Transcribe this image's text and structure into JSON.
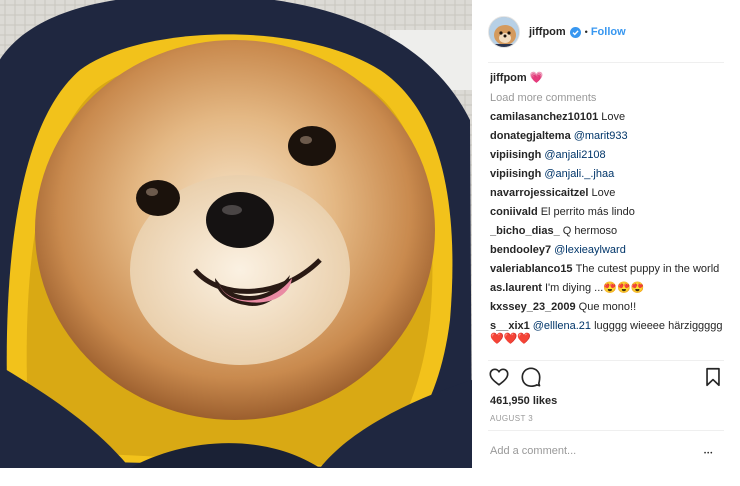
{
  "header": {
    "username": "jiffpom",
    "separator": "•",
    "follow_label": "Follow"
  },
  "caption": {
    "username": "jiffpom",
    "emoji": "💗"
  },
  "load_more_label": "Load more comments",
  "comments": [
    {
      "user": "camilasanchez10101",
      "text": "Love",
      "mention": ""
    },
    {
      "user": "donategjaltema",
      "text": "",
      "mention": "@marit933"
    },
    {
      "user": "vipiisingh",
      "text": "",
      "mention": "@anjali2108"
    },
    {
      "user": "vipiisingh",
      "text": "",
      "mention": "@anjali._.jhaa"
    },
    {
      "user": "navarrojessicaitzel",
      "text": "Love",
      "mention": ""
    },
    {
      "user": "coniivald",
      "text": "El perrito más lindo",
      "mention": ""
    },
    {
      "user": "_bicho_dias_",
      "text": "Q hermoso",
      "mention": ""
    },
    {
      "user": "bendooley7",
      "text": "",
      "mention": "@lexieaylward"
    },
    {
      "user": "valeriablanco15",
      "text": "The cutest puppy in the world",
      "mention": ""
    },
    {
      "user": "as.laurent",
      "text": "I'm diying ...😍😍😍",
      "mention": ""
    },
    {
      "user": "kxssey_23_2009",
      "text": "Que mono!!",
      "mention": ""
    },
    {
      "user": "s__xix1",
      "text": "lugggg wieeee härziggggg❤️❤️❤️",
      "mention": "@elllena.21"
    }
  ],
  "likes_text": "461,950 likes",
  "date_text": "AUGUST 3",
  "add_comment_placeholder": "Add a comment...",
  "more_label": "•••",
  "icons": {
    "like": "heart-outline-icon",
    "comment": "comment-bubble-icon",
    "save": "bookmark-icon",
    "verified": "verified-badge-icon"
  },
  "colors": {
    "link": "#3897f0",
    "mention": "#003569",
    "muted": "#999999",
    "verified": "#3897f0"
  }
}
